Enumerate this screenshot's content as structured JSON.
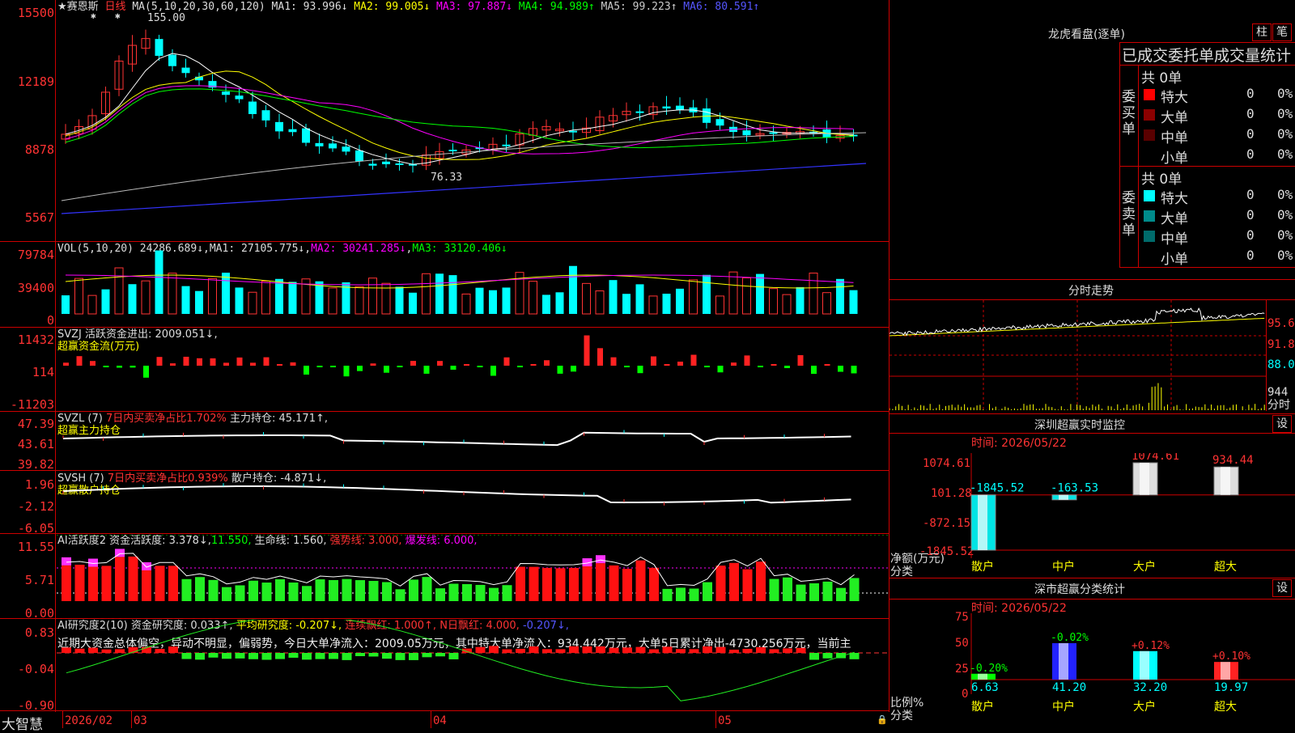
{
  "stock": {
    "name": "赛恩斯",
    "period": "日线",
    "star": "★"
  },
  "main_axis": {
    "labels": [
      "15500",
      "12189",
      "8878",
      "5567"
    ]
  },
  "main_legend": {
    "params": "MA(5,10,20,30,60,120)",
    "ma1": "MA1: 93.996↓",
    "ma2": "MA2: 99.005↓",
    "ma3": "MA3: 97.887↓",
    "ma4": "MA4: 94.989↑",
    "ma5": "MA5: 99.223↑",
    "ma6": "MA6: 80.591↑",
    "high_label": "155.00",
    "low_label": "76.33"
  },
  "vol": {
    "axis": [
      "79784",
      "39400",
      "0"
    ],
    "legend": {
      "params": "VOL(5,10,20)",
      "vol": "24286.689↓",
      "ma1": "MA1: 27105.775↓",
      "ma2": "MA2: 30241.285↓",
      "ma3": "MA3: 33120.406↓"
    }
  },
  "svzj": {
    "axis": [
      "11432",
      "114",
      "-11203"
    ],
    "legend1": "SVZJ  活跃资金进出: 2009.051↓,",
    "legend2": "超赢资金流(万元)"
  },
  "svzl": {
    "axis": [
      "47.39",
      "43.61",
      "39.82"
    ],
    "legend_a": "SVZL (7)",
    "legend_b": "7日内买卖净占比1.702%",
    "legend_c": "主力持仓: 45.171↑,",
    "legend2": "超赢主力持仓"
  },
  "svsh": {
    "axis": [
      "1.96",
      "-2.12",
      "-6.05"
    ],
    "legend_a": "SVSH (7)",
    "legend_b": "7日内买卖净占比0.939%",
    "legend_c": "散户持仓: -4.871↓,",
    "legend2": "超赢散户持仓"
  },
  "ai2": {
    "axis": [
      "11.55",
      "5.71",
      "0.00"
    ],
    "legend_a": "AI活跃度2 资金活跃度: 3.378↓,",
    "legend_b": "11.550,",
    "legend_c": "生命线: 1.560,",
    "legend_d": "强势线: 3.000,",
    "legend_e": "爆发线: 6.000,"
  },
  "ai_research": {
    "axis": [
      "0.83",
      "-0.04",
      "-0.90"
    ],
    "legend_a": "AI研究度2(10) 资金研究度: 0.033↑,",
    "legend_b": "平均研究度: -0.207↓,",
    "legend_c": "连续飘红: 1.000↑,",
    "legend_d": "N日飘红: 4.000,",
    "legend_e": "-0.207↓,",
    "comment": "近期大资金总体偏空，异动不明显，偏弱势，今日大单净流入：2009.05万元，其中特大单净流入：934.442万元，大单5日累计净出-4730.256万元，当前主"
  },
  "bottom_axis": {
    "brand": "大智慧",
    "dates": [
      "2026/02",
      "03",
      "04",
      "05"
    ]
  },
  "dragon_tiger": {
    "title": "龙虎看盘(逐单)",
    "btn_bar": "柱",
    "btn_stroke": "笔",
    "stats_title": "已成交委托单成交量统计"
  },
  "buy_orders": {
    "side_label": "委买单",
    "total": "共 0单",
    "rows": [
      {
        "label": "特大",
        "count": "0",
        "pct": "0%",
        "color": "#ff0000"
      },
      {
        "label": "大单",
        "count": "0",
        "pct": "0%",
        "color": "#8b0000"
      },
      {
        "label": "中单",
        "count": "0",
        "pct": "0%",
        "color": "#5a0000"
      },
      {
        "label": "小单",
        "count": "0",
        "pct": "0%",
        "color": "#000000"
      }
    ]
  },
  "sell_orders": {
    "side_label": "委卖单",
    "total": "共 0单",
    "rows": [
      {
        "label": "特大",
        "count": "0",
        "pct": "0%",
        "color": "#00ffff"
      },
      {
        "label": "大单",
        "count": "0",
        "pct": "0%",
        "color": "#008b8b"
      },
      {
        "label": "中单",
        "count": "0",
        "pct": "0%",
        "color": "#006b6b"
      },
      {
        "label": "小单",
        "count": "0",
        "pct": "0%",
        "color": "#000000"
      }
    ]
  },
  "intraday": {
    "title": "分时走势",
    "axis": [
      "95.60",
      "91.80",
      "88.00",
      "944",
      "分时"
    ]
  },
  "realtime": {
    "title": "深圳超赢实时监控",
    "set": "设",
    "time": "时间: 2026/05/22",
    "axis": [
      "1074.61",
      "101.28",
      "-872.15",
      "-1845.52"
    ],
    "ylabel": "净额(万元)",
    "xlabel": "分类"
  },
  "classify": {
    "title": "深市超赢分类统计",
    "set": "设",
    "time": "时间: 2026/05/22",
    "axis": [
      "75",
      "50",
      "25",
      "0"
    ],
    "ylabel": "比例%",
    "xlabel": "分类"
  },
  "chart_data": [
    {
      "type": "bar",
      "title": "深圳超赢实时监控",
      "ylabel": "净额(万元)",
      "xlabel": "分类",
      "categories": [
        "散户",
        "中户",
        "大户",
        "超大"
      ],
      "values": [
        -1845.52,
        -163.53,
        1074.61,
        934.44
      ],
      "value_labels": [
        "-1845.52",
        "-163.53",
        "1074.61",
        "934.44"
      ],
      "ylim": [
        -1845.52,
        1074.61
      ]
    },
    {
      "type": "bar",
      "title": "深市超赢分类统计",
      "ylabel": "比例%",
      "xlabel": "分类",
      "categories": [
        "散户",
        "中户",
        "大户",
        "超大"
      ],
      "values": [
        6.63,
        41.2,
        32.2,
        19.97
      ],
      "value_labels": [
        "6.63",
        "41.20",
        "32.20",
        "19.97"
      ],
      "changes": [
        "-0.20%",
        "-0.02%",
        "+0.12%",
        "+0.10%"
      ],
      "colors": [
        "#00ff00",
        "#2222ff",
        "#00ffff",
        "#ff2222"
      ],
      "ylim": [
        0,
        75
      ]
    }
  ]
}
